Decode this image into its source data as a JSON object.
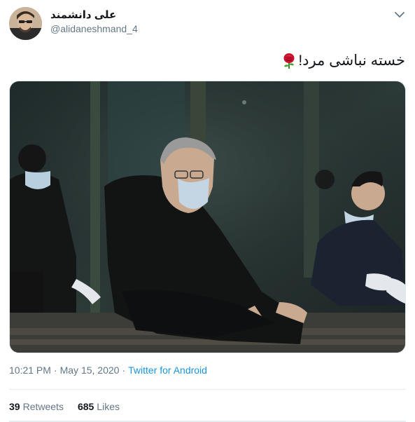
{
  "author": {
    "display_name": "علی دانشمند",
    "handle": "@alidaneshmand_4"
  },
  "tweet": {
    "text": "خسته نباشی مرد!",
    "emoji": "rose-icon"
  },
  "meta": {
    "time": "10:21 PM",
    "separator_1": "·",
    "date": "May 15, 2020",
    "separator_2": "·",
    "source": "Twitter for Android"
  },
  "stats": {
    "retweets_count": "39",
    "retweets_label": "Retweets",
    "likes_count": "685",
    "likes_label": "Likes"
  },
  "colors": {
    "link": "#1b95e0",
    "secondary_text": "#657786",
    "primary_text": "#14171a",
    "divider": "#e6ecf0"
  },
  "icons": {
    "more": "chevron-down-icon"
  }
}
